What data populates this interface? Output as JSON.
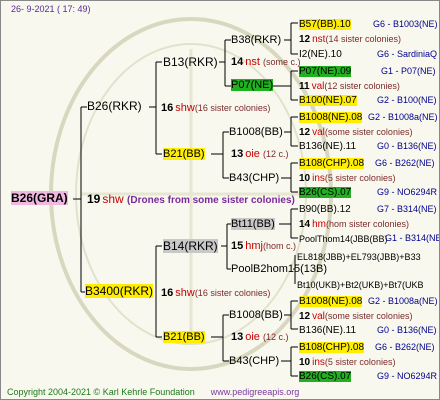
{
  "header": {
    "date": "26-  9-2021  ( 17:  49)"
  },
  "footer": {
    "copyright": "Copyright 2004-2021 © Karl Kehrle Foundation",
    "url": "www.pedigreeapis.org"
  },
  "root": {
    "name": "B26(GRA)",
    "num": "19",
    "shw": "shw",
    "note": "(Drones from some sister colonies)"
  },
  "nodes": {
    "b26rkr": "B26(RKR)",
    "b26rkr_num": "16",
    "b26rkr_tag": "shw",
    "b26rkr_note": "(16 sister colonies)",
    "b13": "B13(RKR)",
    "b13_num": "14",
    "b13_tag": "nst",
    "b13_note": "(some c.)",
    "b38": "B38(RKR)",
    "b38_num": "12",
    "b38_tag": "nst",
    "b38_note": "(14 sister colonies)",
    "p07": "P07(NE)",
    "p07_num": "11",
    "p07_tag": "val",
    "p07_note": "(12 sister colonies)",
    "b21a": "B21(BB)",
    "b21a_num": "13",
    "b21a_tag": "oie",
    "b21a_note": "(12 c.)",
    "b1008a": "B1008(BB)",
    "b1008a_num": "12",
    "b1008a_tag": "val",
    "b1008a_note": "(some sister colonies)",
    "b43a": "B43(CHP)",
    "b43a_num": "10",
    "b43a_tag": "ins",
    "b43a_note": "(5 sister colonies)",
    "b3400": "B3400(RKR)",
    "b3400_num": "16",
    "b3400_tag": "shw",
    "b3400_note": "(16 sister colonies)",
    "b14": "B14(RKR)",
    "b14_num": "15",
    "b14_tag": "hmj",
    "b14_note": "(hom c.)",
    "bt11": "Bt11(BB)",
    "bt11_num": "14",
    "bt11_tag": "hm",
    "bt11_note": "(hom sister colonies)",
    "pool2": "PoolB2hom15(13B)",
    "b21b": "B21(BB)",
    "b21b_num": "13",
    "b21b_tag": "oie",
    "b21b_note": "(12 c.)",
    "b1008b": "B1008(BB)",
    "b1008b_num": "12",
    "b1008b_tag": "val",
    "b1008b_note": "(some sister colonies)",
    "b43b": "B43(CHP)",
    "b43b_num": "10",
    "b43b_tag": "ins",
    "b43b_note": "(5 sister colonies)"
  },
  "gen4": [
    {
      "name": "B57(BB).10",
      "hl": "y",
      "code": "G6 - B1003(NE)"
    },
    {
      "name": "I2(NE).10",
      "hl": "",
      "code": "G6 - SardiniaQ"
    },
    {
      "name": "P07(NE).09",
      "hl": "g",
      "code": "G1 - P07(NE)"
    },
    {
      "name": "B100(NE).07",
      "hl": "y",
      "code": "G2 - B100(NE)"
    },
    {
      "name": "B1008(NE).08",
      "hl": "y",
      "code": "G2 - B1008a(NE)"
    },
    {
      "name": "B136(NE).11",
      "hl": "",
      "code": "G0 - B136(NE)"
    },
    {
      "name": "B108(CHP).08",
      "hl": "y",
      "code": "G6 - B262(NE)"
    },
    {
      "name": "B26(CS).07",
      "hl": "g",
      "code": "G9 - NO6294R"
    },
    {
      "name": "B90(BB).12",
      "hl": "",
      "code": "G7 - B314(NE)"
    },
    {
      "name": "PoolThom14(JBB(BB)",
      "hl": "",
      "code": "G1 - B314(NE)"
    },
    {
      "name": "EL818(JBB)+EL793(JBB)+B33",
      "hl": "",
      "code": ""
    },
    {
      "name": "Bt10(UKB)+Bt2(UKB)+Bt7(UKB",
      "hl": "",
      "code": ""
    },
    {
      "name": "B1008(NE).08",
      "hl": "y",
      "code": "G2 - B1008a(NE)"
    },
    {
      "name": "B136(NE).11",
      "hl": "",
      "code": "G0 - B136(NE)"
    },
    {
      "name": "B108(CHP).08",
      "hl": "y",
      "code": "G6 - B262(NE)"
    },
    {
      "name": "B26(CS).07",
      "hl": "g",
      "code": "G9 - NO6294R"
    }
  ],
  "gen4_notes": [
    {
      "num": "12",
      "tag": "nst",
      "note": "(14 sister colonies)"
    },
    {
      "num": "11",
      "tag": "val",
      "note": "(12 sister colonies)"
    },
    {
      "num": "12",
      "tag": "val",
      "note": "(some sister colonies)"
    },
    {
      "num": "10",
      "tag": "ins",
      "note": "(5 sister colonies)"
    },
    {
      "num": "14",
      "tag": "hm",
      "note": "(hom sister colonies)"
    },
    {
      "num": "12",
      "tag": "val",
      "note": "(some sister colonies)"
    },
    {
      "num": "10",
      "tag": "ins",
      "note": "(5 sister colonies)"
    }
  ],
  "colors": {
    "highlight_yellow": "#ffee00",
    "highlight_green": "#20b020",
    "highlight_root": "#f0b8e0",
    "highlight_gray": "#c8c8c8"
  }
}
